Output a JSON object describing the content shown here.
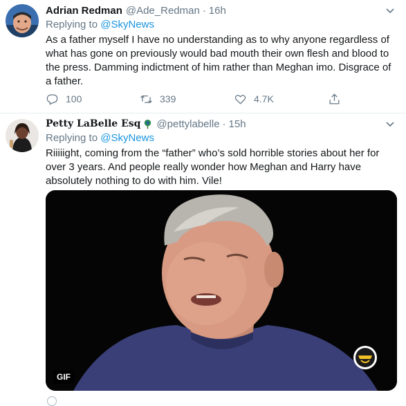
{
  "tweets": [
    {
      "name": "Adrian Redman",
      "handle": "@Ade_Redman",
      "separator": "·",
      "time": "16h",
      "replying_prefix": "Replying to ",
      "replying_to": "@SkyNews",
      "text": "As a father myself I have no understanding as to why anyone regardless of what has gone on previously would bad mouth their own flesh and blood to the press. Damming indictment of him rather than Meghan imo. Disgrace of a father.",
      "replies": "100",
      "retweets": "339",
      "likes": "4.7K"
    },
    {
      "name": "Petty LaBelle Esq",
      "handle": "@pettylabelle",
      "separator": "·",
      "time": "15h",
      "replying_prefix": "Replying to ",
      "replying_to": "@SkyNews",
      "text": "Riiiiight, coming from the “father” who’s sold horrible stories about her for over 3 years. And people really wonder how Meghan and Harry have absolutely nothing to do with him. Vile!",
      "media_label": "GIF"
    }
  ],
  "icons": {
    "reply": "reply-icon",
    "retweet": "retweet-icon",
    "like": "heart-icon",
    "share": "share-icon",
    "caret": "chevron-down-icon"
  },
  "colors": {
    "link": "#1b95e0",
    "muted": "#657786",
    "divider": "#e6ecf0"
  }
}
